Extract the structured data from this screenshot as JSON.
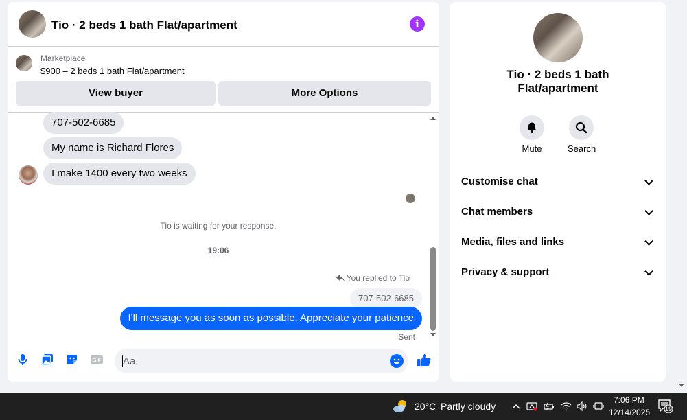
{
  "chat": {
    "title": "Tio · 2 beds 1 bath Flat/apartment",
    "marketplace_label": "Marketplace",
    "listing": "$900 – 2 beds 1 bath Flat/apartment",
    "view_buyer": "View buyer",
    "more_options": "More Options",
    "messages": [
      "707-502-6685",
      "My name is Richard Flores",
      "I make 1400 every two weeks"
    ],
    "waiting": "Tio is waiting for your response.",
    "time": "19:06",
    "replied_label": "You replied to Tio",
    "reply_quote": "707-502-6685",
    "outgoing": "I'll message you as soon as possible. Appreciate your patience",
    "status": "Sent",
    "input_placeholder": "Aa",
    "accent_color": "#0866ff"
  },
  "sidebar": {
    "title": "Tio · 2 beds 1 bath Flat/apartment",
    "mute": "Mute",
    "search": "Search",
    "sections": [
      "Customise chat",
      "Chat members",
      "Media, files and links",
      "Privacy & support"
    ]
  },
  "taskbar": {
    "temp": "20°C",
    "weather": "Partly cloudy",
    "time": "7:06 PM",
    "date": "12/14/2025",
    "notifications": "19"
  }
}
